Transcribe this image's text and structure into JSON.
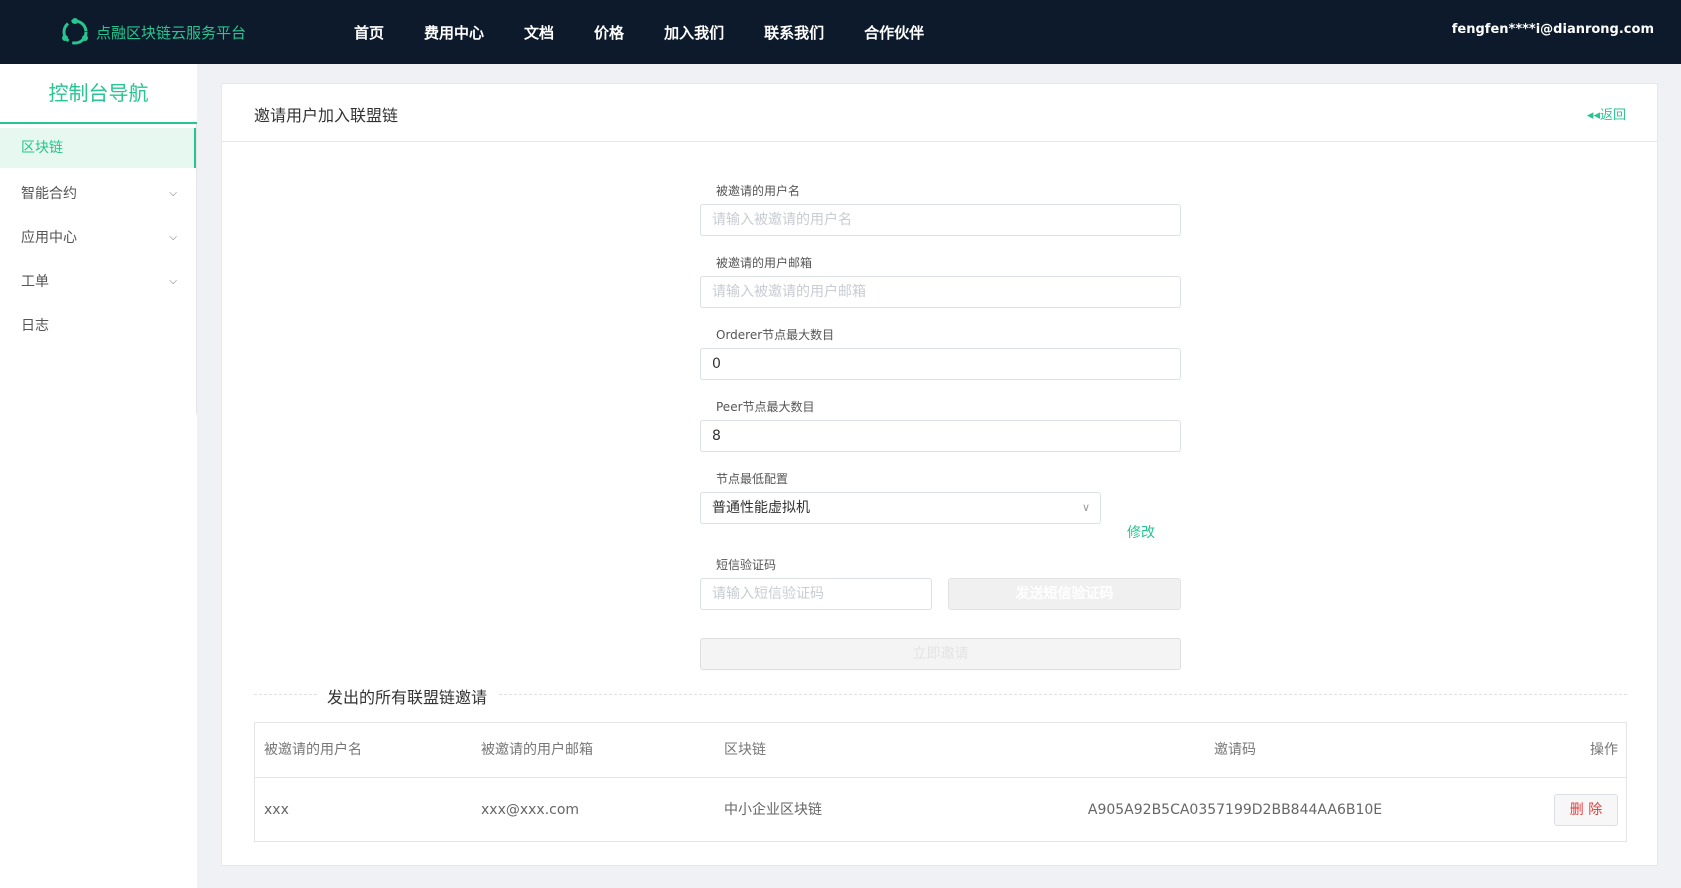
{
  "header": {
    "brand": "点融区块链云服务平台",
    "nav": [
      "首页",
      "费用中心",
      "文档",
      "价格",
      "加入我们",
      "联系我们",
      "合作伙伴"
    ],
    "user_email": "fengfen****i@dianrong.com"
  },
  "sidebar": {
    "title": "控制台导航",
    "items": [
      {
        "label": "区块链"
      },
      {
        "label": "智能合约"
      },
      {
        "label": "应用中心"
      },
      {
        "label": "工单"
      },
      {
        "label": "日志"
      }
    ]
  },
  "main": {
    "title": "邀请用户加入联盟链",
    "back_label": "返回",
    "form": {
      "username_label": "被邀请的用户名",
      "username_placeholder": "请输入被邀请的用户名",
      "email_label": "被邀请的用户邮箱",
      "email_placeholder": "请输入被邀请的用户邮箱",
      "orderer_label": "Orderer节点最大数目",
      "orderer_value": "0",
      "peer_label": "Peer节点最大数目",
      "peer_value": "8",
      "config_label": "节点最低配置",
      "config_value": "普通性能虚拟机",
      "modify_label": "修改",
      "sms_label": "短信验证码",
      "sms_placeholder": "请输入短信验证码",
      "sms_button": "发送短信验证码",
      "invite_button": "立即邀请"
    },
    "section_title": "发出的所有联盟链邀请",
    "table": {
      "headers": [
        "被邀请的用户名",
        "被邀请的用户邮箱",
        "区块链",
        "邀请码",
        "操作"
      ],
      "rows": [
        {
          "username": "xxx",
          "email": "xxx@xxx.com",
          "chain": "中小企业区块链",
          "code": "A905A92B5CA0357199D2BB844AA6B10E",
          "action": "删 除"
        }
      ]
    }
  },
  "colors": {
    "accent": "#27c590",
    "topbar": "#0c1a2b",
    "danger": "#e04040"
  }
}
